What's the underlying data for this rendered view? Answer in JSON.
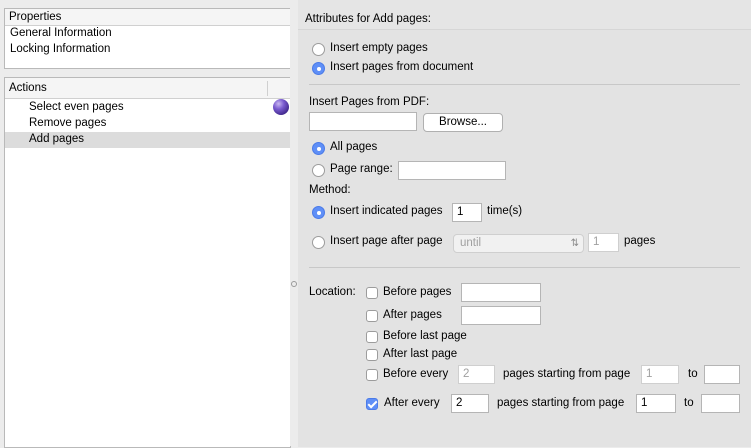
{
  "properties": {
    "title": "Properties",
    "items": [
      "General Information",
      "Locking Information"
    ]
  },
  "actions": {
    "title": "Actions",
    "items": [
      "Select even pages",
      "Remove pages",
      "Add pages"
    ],
    "selected_index": 2
  },
  "attributes": {
    "title": "Attributes for Add pages:",
    "insert_mode": {
      "options": [
        "Insert empty pages",
        "Insert pages from document"
      ],
      "selected": 1
    },
    "insert_from_pdf_label": "Insert Pages from PDF:",
    "pdf_path": "",
    "browse_label": "Browse...",
    "page_selection": {
      "all_pages_label": "All pages",
      "page_range_label": "Page range:",
      "page_range_value": "",
      "selected": "all"
    },
    "method": {
      "label": "Method:",
      "insert_indicated_label": "Insert indicated pages",
      "times_value": "1",
      "times_suffix": "time(s)",
      "insert_after_label": "Insert page after page",
      "until_option": "until",
      "pages_value": "1",
      "pages_suffix": "pages",
      "selected": "indicated"
    },
    "location": {
      "label": "Location:",
      "before_pages_label": "Before pages",
      "before_pages_value": "",
      "before_pages_checked": false,
      "after_pages_label": "After pages",
      "after_pages_value": "",
      "after_pages_checked": false,
      "before_last_label": "Before last page",
      "before_last_checked": false,
      "after_last_label": "After last page",
      "after_last_checked": false,
      "before_every": {
        "label": "Before every",
        "count": "2",
        "middle": "pages starting from page",
        "start": "1",
        "to": "to",
        "end": "",
        "checked": false
      },
      "after_every": {
        "label": "After every",
        "count": "2",
        "middle": "pages starting from page",
        "start": "1",
        "to": "to",
        "end": "",
        "checked": true
      }
    }
  },
  "colors": {
    "accent": "#5f8ff7",
    "selection_row": "#dcdcdc",
    "panel_bg": "#e3e3e3"
  }
}
